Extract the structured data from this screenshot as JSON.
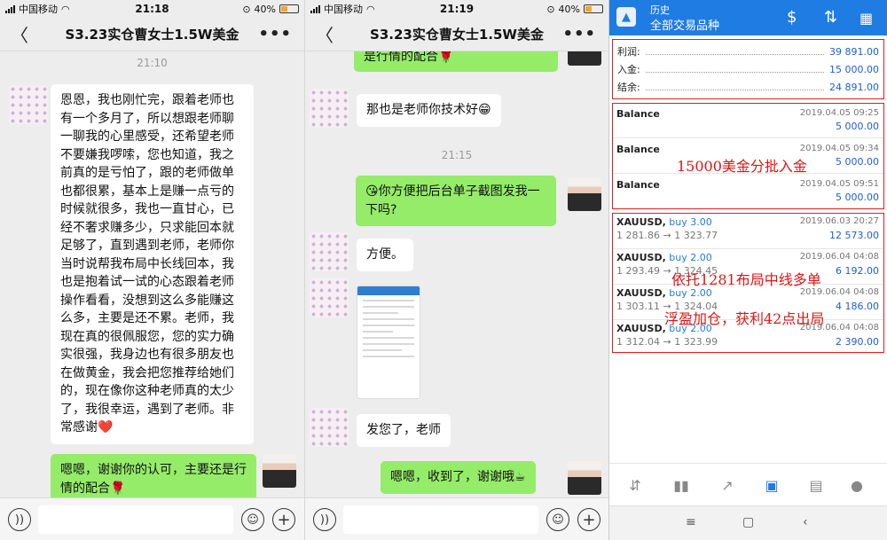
{
  "screen1": {
    "status": {
      "carrier": "中国移动",
      "time": "21:18",
      "battery": "40%",
      "battery_level": 0.4
    },
    "title": "S3.23实仓曹女士1.5W美金",
    "timestamp": "21:10",
    "messages": [
      {
        "side": "left",
        "text": "恩恩，我也刚忙完，跟着老师也有一个多月了，所以想跟老师聊一聊我的心里感受，还希望老师不要嫌我啰嗦，您也知道，我之前真的是亏怕了，跟的老师做单也都很累，基本上是赚一点亏的时候就很多，我也一直甘心，已经不奢求赚多少，只求能回本就足够了，直到遇到老师，老师你当时说帮我布局中长线回本，我也是抱着试一试的心态跟着老师操作看看，没想到这么多能赚这么多，主要是还不累。老师，我现在真的很佩服您，您的实力确实很强，我身边也有很多朋友也在做黄金，我会把您推荐给她们的，现在像你这种老师真的太少了，我很幸运，遇到了老师。非常感谢❤️"
      },
      {
        "side": "right",
        "text": "嗯嗯，谢谢你的认可，主要还是行情的配合🌹"
      }
    ]
  },
  "screen2": {
    "status": {
      "carrier": "中国移动",
      "time": "21:19",
      "battery": "40%",
      "battery_level": 0.4
    },
    "title": "S3.23实仓曹女士1.5W美金",
    "top_partial": "是行情的配合🌹",
    "timestamp": "21:15",
    "messages": [
      {
        "side": "left",
        "text": "那也是老师你技术好😁"
      },
      {
        "side": "right",
        "text": "😘你方便把后台单子截图发我一下吗?"
      },
      {
        "side": "left",
        "text": "方便。"
      },
      {
        "side": "left",
        "type": "image"
      },
      {
        "side": "left",
        "text": "发您了，老师"
      },
      {
        "side": "right",
        "text": "嗯嗯，收到了，谢谢哦☕"
      }
    ]
  },
  "screen3": {
    "header": {
      "title": "历史",
      "subtitle": "全部交易品种"
    },
    "summary": [
      {
        "label": "利润:",
        "value": "39 891.00"
      },
      {
        "label": "入金:",
        "value": "15 000.00"
      },
      {
        "label": "结余:",
        "value": "24 891.00"
      }
    ],
    "balances": [
      {
        "name": "Balance",
        "date": "2019.04.05 09:25",
        "amount": "5 000.00"
      },
      {
        "name": "Balance",
        "date": "2019.04.05 09:34",
        "amount": "5 000.00"
      },
      {
        "name": "Balance",
        "date": "2019.04.05 09:51",
        "amount": "5 000.00"
      }
    ],
    "trades": [
      {
        "symbol": "XAUUSD,",
        "side": "buy 3.00",
        "date": "2019.06.03 20:27",
        "prices": "1 281.86 → 1 323.77",
        "profit": "12 573.00"
      },
      {
        "symbol": "XAUUSD,",
        "side": "buy 2.00",
        "date": "2019.06.04 04:08",
        "prices": "1 293.49 → 1 324.45",
        "profit": "6 192.00"
      },
      {
        "symbol": "XAUUSD,",
        "side": "buy 2.00",
        "date": "2019.06.04 04:08",
        "prices": "1 303.11 → 1 324.04",
        "profit": "4 186.00"
      },
      {
        "symbol": "XAUUSD,",
        "side": "buy 2.00",
        "date": "2019.06.04 04:08",
        "prices": "1 312.04 → 1 323.99",
        "profit": "2 390.00"
      }
    ],
    "annotations": {
      "deposit": "15000美金分批入金",
      "layout": "依托1281布局中线多单",
      "profit": "浮盈加仓，获利42点出局"
    }
  },
  "colors": {
    "wechat_green": "#95ec69",
    "mt_blue": "#1f7ce3",
    "annotation_red": "#d81818"
  }
}
